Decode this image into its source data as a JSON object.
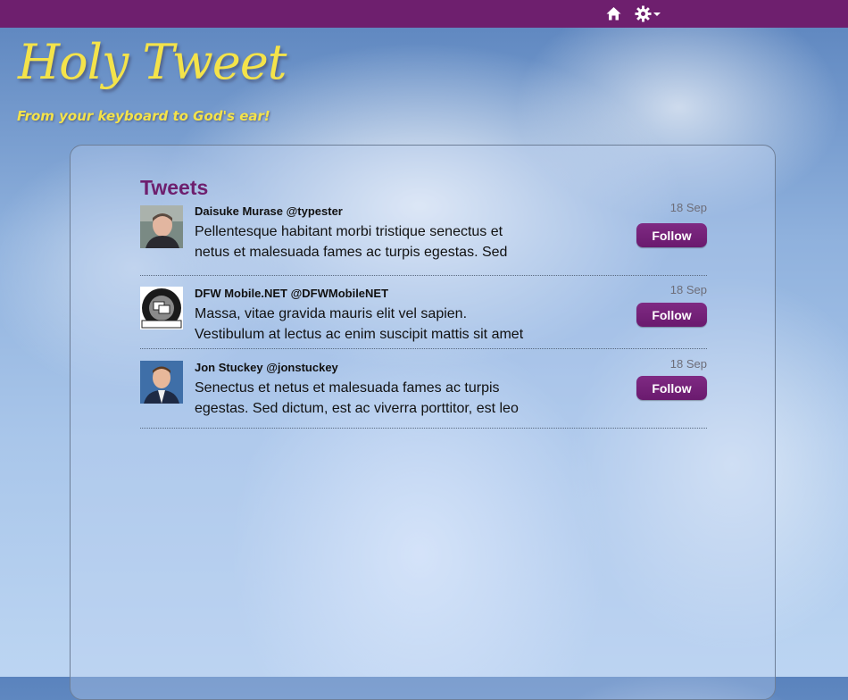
{
  "colors": {
    "brand": "#6e1f6e",
    "logo": "#f4e34a"
  },
  "topbar": {
    "icons": [
      "home-icon",
      "gear-icon",
      "caret-down-icon"
    ]
  },
  "header": {
    "logo": "Holy Tweet",
    "tagline": "From your keyboard to God's ear!"
  },
  "main": {
    "title": "Tweets",
    "tweets": [
      {
        "author": "Daisuke Murase @typester",
        "line1": "Pellentesque habitant morbi tristique senectus et",
        "line2": "netus et malesuada fames ac turpis egestas. Sed",
        "date": "18 Sep",
        "follow_label": "Follow"
      },
      {
        "author": "DFW Mobile.NET @DFWMobileNET",
        "line1": "Massa, vitae gravida mauris elit vel sapien.",
        "line2": "Vestibulum at lectus ac enim suscipit mattis sit amet",
        "date": "18 Sep",
        "follow_label": "Follow"
      },
      {
        "author": "Jon Stuckey @jonstuckey",
        "line1": "Senectus et netus et malesuada fames ac turpis",
        "line2": "egestas. Sed dictum, est ac viverra porttitor, est leo",
        "date": "18 Sep",
        "follow_label": "Follow"
      }
    ]
  }
}
